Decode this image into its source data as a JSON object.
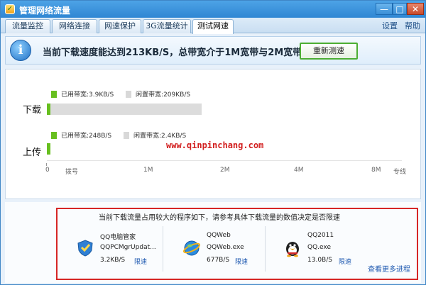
{
  "window": {
    "title": "管理网络流量",
    "minimize": "—",
    "maximize": "□",
    "close": "✕"
  },
  "tabs": [
    {
      "label": "流量监控",
      "active": false
    },
    {
      "label": "网络连接",
      "active": false
    },
    {
      "label": "网速保护",
      "active": false
    },
    {
      "label": "3G流量统计",
      "active": false
    },
    {
      "label": "测试网速",
      "active": true
    }
  ],
  "toplinks": {
    "settings": "设置",
    "help": "帮助"
  },
  "banner": {
    "icon": "info-icon",
    "text": "当前下载速度能达到213KB/S，总带宽介于1M宽带与2M宽带之间",
    "retest_button": "重新测速"
  },
  "graph": {
    "download_label": "下载",
    "upload_label": "上传",
    "download_used": "已用带宽:3.9KB/S",
    "download_idle": "闲置带宽:209KB/S",
    "upload_used": "已用带宽:248B/S",
    "upload_idle": "闲置带宽:2.4KB/S",
    "ticks": [
      "0",
      "拨号",
      "1M",
      "2M",
      "4M",
      "8M",
      "专线"
    ],
    "watermark": "www.qinpinchang.com",
    "colors": {
      "used": "#67bf1f",
      "idle": "#dcdcdc"
    }
  },
  "bottom": {
    "title": "当前下载流量占用较大的程序如下，请参考具体下载流量的数值决定是否限速",
    "apps": [
      {
        "name": "QQ电脑管家",
        "exe": "QQPCMgrUpdat...",
        "speed": "3.2KB/S",
        "limit": "限速",
        "icon": "qq-pc-manager-icon"
      },
      {
        "name": "QQWeb",
        "exe": "QQWeb.exe",
        "speed": "677B/S",
        "limit": "限速",
        "icon": "qqweb-globe-icon"
      },
      {
        "name": "QQ2011",
        "exe": "QQ.exe",
        "speed": "13.0B/S",
        "limit": "限速",
        "icon": "qq-penguin-icon"
      }
    ],
    "more_link": "查看更多进程"
  }
}
